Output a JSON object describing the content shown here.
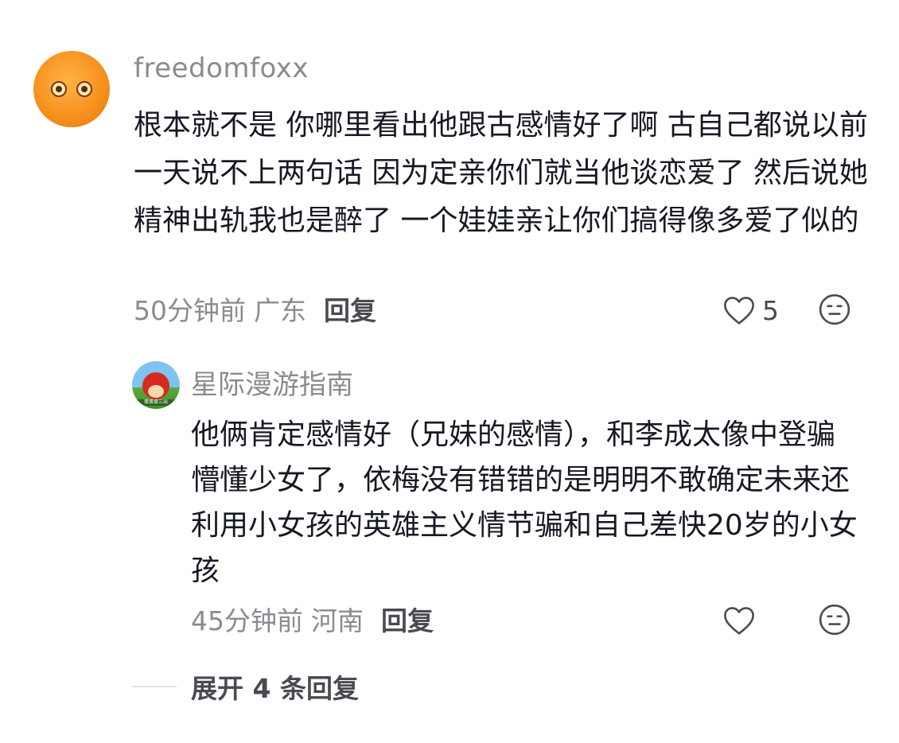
{
  "comment": {
    "avatar_icon": "orange-face-avatar",
    "username": "freedomfoxx",
    "content": "根本就不是 你哪里看出他跟古感情好了啊 古自己都说以前一天说不上两句话 因为定亲你们就当他谈恋爱了 然后说她精神出轨我也是醉了 一个娃娃亲让你们搞得像多爱了似的",
    "time": "50分钟前",
    "location": "广东",
    "reply_label": "回复",
    "like_count": "5",
    "like_icon": "heart-outline-icon",
    "dislike_icon": "meh-face-icon"
  },
  "reply": {
    "avatar_icon": "red-bird-avatar",
    "avatar_caption": "蛋蛋蛋三出",
    "username": "星际漫游指南",
    "content": "他俩肯定感情好（兄妹的感情），和李成太像中登骗懵懂少女了，依梅没有错错的是明明不敢确定未来还利用小女孩的英雄主义情节骗和自己差快20岁的小女孩",
    "time": "45分钟前",
    "location": "河南",
    "reply_label": "回复",
    "like_icon": "heart-outline-icon",
    "dislike_icon": "meh-face-icon"
  },
  "expand_replies": {
    "label": "展开 4 条回复"
  },
  "colors": {
    "text_primary": "#161823",
    "text_secondary": "#8a8b91",
    "action_text": "#4a4b52",
    "divider": "#e2e2e4"
  }
}
